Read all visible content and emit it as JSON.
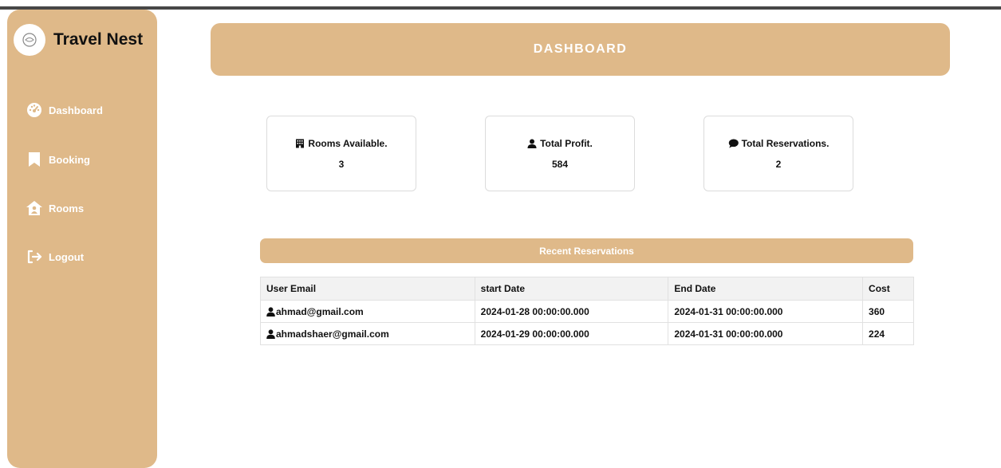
{
  "app": {
    "name": "Travel Nest"
  },
  "sidebar": {
    "items": [
      {
        "label": "Dashboard",
        "icon": "gauge-icon"
      },
      {
        "label": "Booking",
        "icon": "bookmark-icon"
      },
      {
        "label": "Rooms",
        "icon": "house-user-icon"
      },
      {
        "label": "Logout",
        "icon": "logout-icon"
      }
    ]
  },
  "header": {
    "title": "DASHBOARD"
  },
  "stats": [
    {
      "label": "Rooms Available.",
      "value": "3",
      "icon": "hotel-icon"
    },
    {
      "label": "Total Profit.",
      "value": "584",
      "icon": "user-icon"
    },
    {
      "label": "Total Reservations.",
      "value": "2",
      "icon": "comment-icon"
    }
  ],
  "reservations": {
    "title": "Recent Reservations",
    "columns": [
      "User Email",
      "start Date",
      "End Date",
      "Cost"
    ],
    "rows": [
      {
        "email": "ahmad@gmail.com",
        "start": "2024-01-28 00:00:00.000",
        "end": "2024-01-31 00:00:00.000",
        "cost": "360"
      },
      {
        "email": "ahmadshaer@gmail.com",
        "start": "2024-01-29 00:00:00.000",
        "end": "2024-01-31 00:00:00.000",
        "cost": "224"
      }
    ]
  },
  "colors": {
    "accent": "#dfb989",
    "topbar": "#474747"
  }
}
